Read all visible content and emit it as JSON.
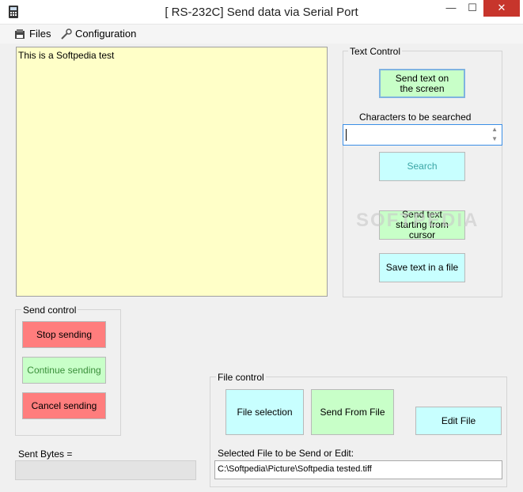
{
  "window": {
    "title": "[ RS-232C] Send data via Serial Port",
    "minimize": "—",
    "maximize": "☐",
    "close": "✕"
  },
  "menu": {
    "files": "Files",
    "configuration": "Configuration"
  },
  "main_text": "This is a Softpedia test",
  "text_control": {
    "legend": "Text Control",
    "send_screen": "Send text on the screen",
    "chars_label": "Characters to be searched",
    "search_value": "",
    "search": "Search",
    "send_from_cursor": "Send text starting from cursor",
    "save_text": "Save text in a file"
  },
  "send_control": {
    "legend": "Send control",
    "stop": "Stop sending",
    "continue": "Continue sending",
    "cancel": "Cancel sending"
  },
  "sent_bytes": {
    "label": "Sent Bytes =",
    "value": ""
  },
  "file_control": {
    "legend": "File control",
    "file_selection": "File selection",
    "send_from_file": "Send From File",
    "edit_file": "Edit File",
    "selected_label": "Selected File to be Send or Edit:",
    "selected_path": "C:\\Softpedia\\Picture\\Softpedia tested.tiff"
  },
  "watermark": "SOFTPEDIA",
  "colors": {
    "text_area": "#ffffc8",
    "green_button": "#c8ffc8",
    "cyan_button": "#c8ffff",
    "red_button": "#ff7d7d",
    "close_button": "#c7352c"
  }
}
